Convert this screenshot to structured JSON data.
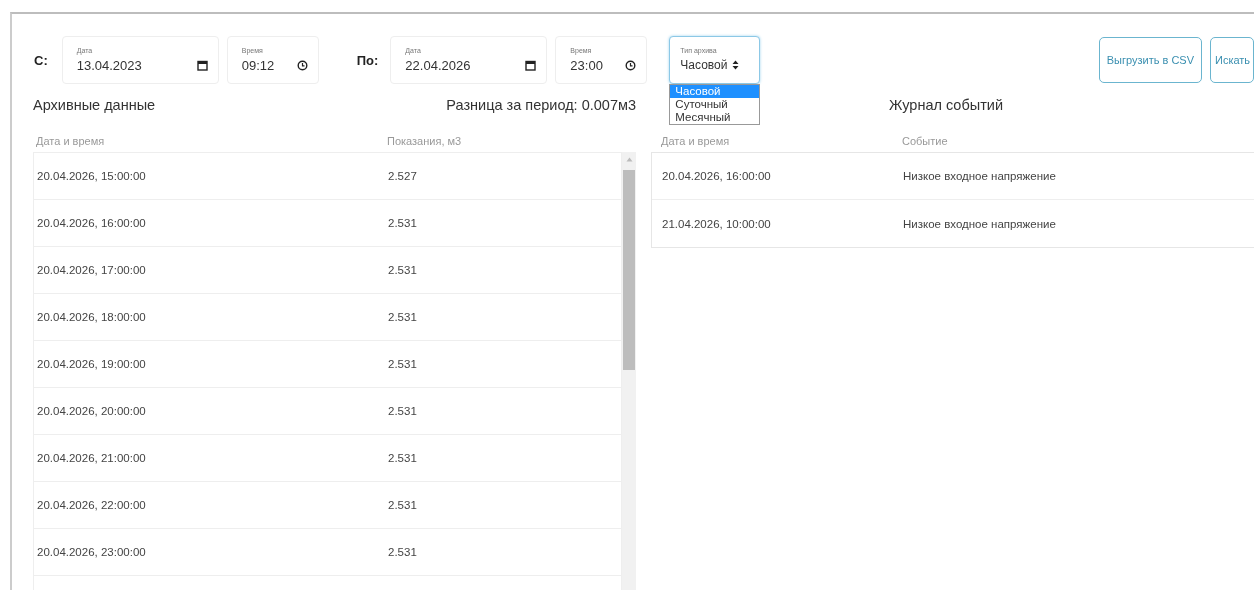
{
  "filters": {
    "from_label": "С:",
    "from_date": {
      "label": "Дата",
      "value": "13.04.2023"
    },
    "from_time": {
      "label": "Время",
      "value": "09:12"
    },
    "to_label": "По:",
    "to_date": {
      "label": "Дата",
      "value": "22.04.2026"
    },
    "to_time": {
      "label": "Время",
      "value": "23:00"
    },
    "archive_type": {
      "label": "Тип архива",
      "value": "Часовой",
      "expanded": true,
      "options": [
        {
          "label": "Часовой",
          "selected": true
        },
        {
          "label": "Суточный",
          "selected": false
        },
        {
          "label": "Месячный",
          "selected": false
        }
      ]
    }
  },
  "buttons": [
    "Выгрузить в CSV",
    "Искать"
  ],
  "archive": {
    "title": "Архивные данные",
    "difference": "Разница за период: 0.007м3",
    "columns": [
      "Дата и время",
      "Показания, м3"
    ],
    "rows": [
      [
        "20.04.2026, 15:00:00",
        "2.527"
      ],
      [
        "20.04.2026, 16:00:00",
        "2.531"
      ],
      [
        "20.04.2026, 17:00:00",
        "2.531"
      ],
      [
        "20.04.2026, 18:00:00",
        "2.531"
      ],
      [
        "20.04.2026, 19:00:00",
        "2.531"
      ],
      [
        "20.04.2026, 20:00:00",
        "2.531"
      ],
      [
        "20.04.2026, 21:00:00",
        "2.531"
      ],
      [
        "20.04.2026, 22:00:00",
        "2.531"
      ],
      [
        "20.04.2026, 23:00:00",
        "2.531"
      ]
    ]
  },
  "events": {
    "title": "Журнал событий",
    "columns": [
      "Дата и время",
      "Событие"
    ],
    "rows": [
      [
        "20.04.2026, 16:00:00",
        "Низкое входное напряжение"
      ],
      [
        "21.04.2026, 10:00:00",
        "Низкое входное напряжение"
      ]
    ]
  }
}
